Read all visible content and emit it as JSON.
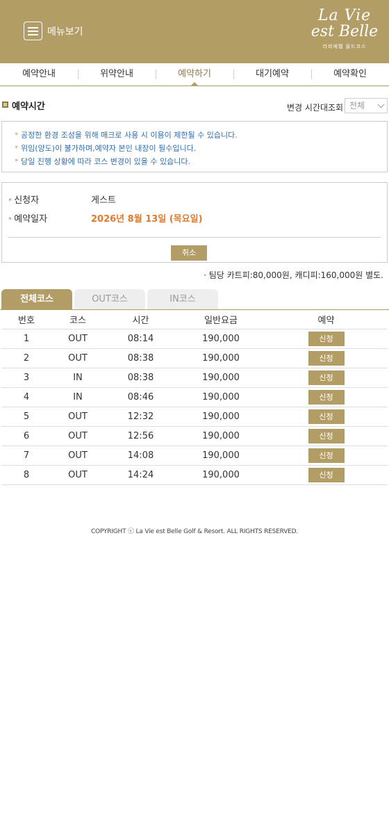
{
  "header": {
    "menu_label": "메뉴보기",
    "logo_line1": "La Vie",
    "logo_line2": "est Belle",
    "logo_sub": "라비에벨 올드코스"
  },
  "nav": {
    "tabs": [
      "예약안내",
      "위약안내",
      "예약하기",
      "대기예약",
      "예약확인"
    ],
    "active_index": 2
  },
  "section": {
    "title": "예약시간",
    "filter_label": "변경 시간대조회",
    "filter_value": "전체"
  },
  "notices": [
    "공정한 환경 조성을 위해 매크로 사용 시 이용이 제한될 수 있습니다.",
    "위임(양도)이 불가하며,예약자 본인 내장이 필수입니다.",
    "당일 진행 상황에 따라 코스 변경이 있을 수 있습니다."
  ],
  "application": {
    "applicant_label": "신청자",
    "applicant_value": "게스트",
    "date_label": "예약일자",
    "date_value": "2026년 8월 13일 (목요일)",
    "cancel_label": "취소"
  },
  "fee_note": "· 팀당 카트피:80,000원, 캐디피:160,000원 별도.",
  "course_tabs": [
    "전체코스",
    "OUT코스",
    "IN코스"
  ],
  "table": {
    "headers": [
      "번호",
      "코스",
      "시간",
      "일반요금",
      "예약"
    ],
    "rows": [
      {
        "no": "1",
        "course": "OUT",
        "time": "08:14",
        "fee": "190,000",
        "action": "신청"
      },
      {
        "no": "2",
        "course": "OUT",
        "time": "08:38",
        "fee": "190,000",
        "action": "신청"
      },
      {
        "no": "3",
        "course": "IN",
        "time": "08:38",
        "fee": "190,000",
        "action": "신청"
      },
      {
        "no": "4",
        "course": "IN",
        "time": "08:46",
        "fee": "190,000",
        "action": "신청"
      },
      {
        "no": "5",
        "course": "OUT",
        "time": "12:32",
        "fee": "190,000",
        "action": "신청"
      },
      {
        "no": "6",
        "course": "OUT",
        "time": "12:56",
        "fee": "190,000",
        "action": "신청"
      },
      {
        "no": "7",
        "course": "OUT",
        "time": "14:08",
        "fee": "190,000",
        "action": "신청"
      },
      {
        "no": "8",
        "course": "OUT",
        "time": "14:24",
        "fee": "190,000",
        "action": "신청"
      }
    ]
  },
  "copyright": "COPYRIGHT ⓒ La Vie est Belle Golf & Resort. ALL RIGHTS RESERVED.",
  "colors": {
    "brand": "#b39d67",
    "accent_date": "#e07a2d",
    "notice_text": "#2f6db0"
  }
}
